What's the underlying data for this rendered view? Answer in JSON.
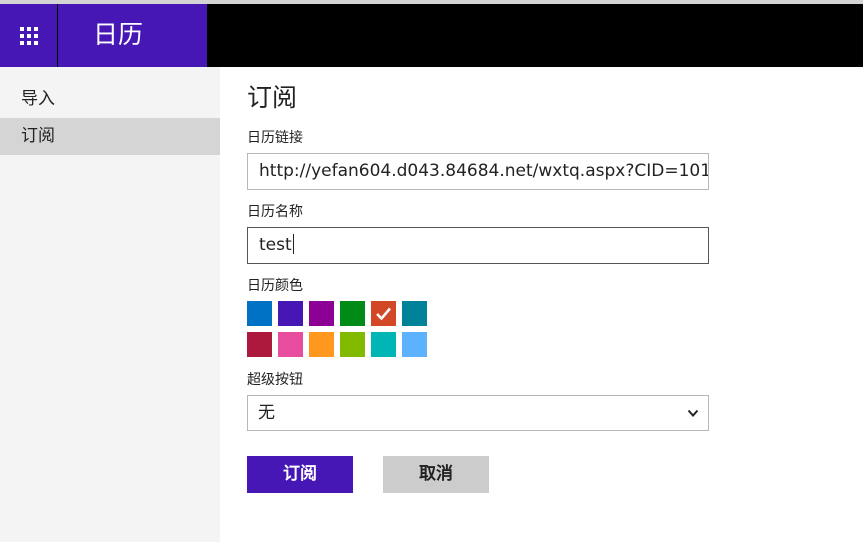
{
  "app": {
    "title": "日历",
    "launcher_icon": "waffle-grid-icon",
    "brand_color": "#4617b4"
  },
  "sidebar": {
    "items": [
      {
        "label": "导入",
        "active": false
      },
      {
        "label": "订阅",
        "active": true
      }
    ]
  },
  "form": {
    "title": "订阅",
    "url_label": "日历链接",
    "url_value": "http://yefan604.d043.84684.net/wxtq.aspx?CID=101",
    "name_label": "日历名称",
    "name_value": "test",
    "color_label": "日历颜色",
    "colors": [
      "#0072c6",
      "#4617b4",
      "#8c0095",
      "#008a17",
      "#d24726",
      "#008299",
      "#ac193d",
      "#e84c9f",
      "#ff981d",
      "#82ba00",
      "#00b5b5",
      "#5db2ff"
    ],
    "selected_color": "#d24726",
    "charm_label": "超级按钮",
    "charm_value": "无",
    "charm_dropdown_icon": "chevron-down-icon",
    "subscribe_label": "订阅",
    "cancel_label": "取消"
  }
}
